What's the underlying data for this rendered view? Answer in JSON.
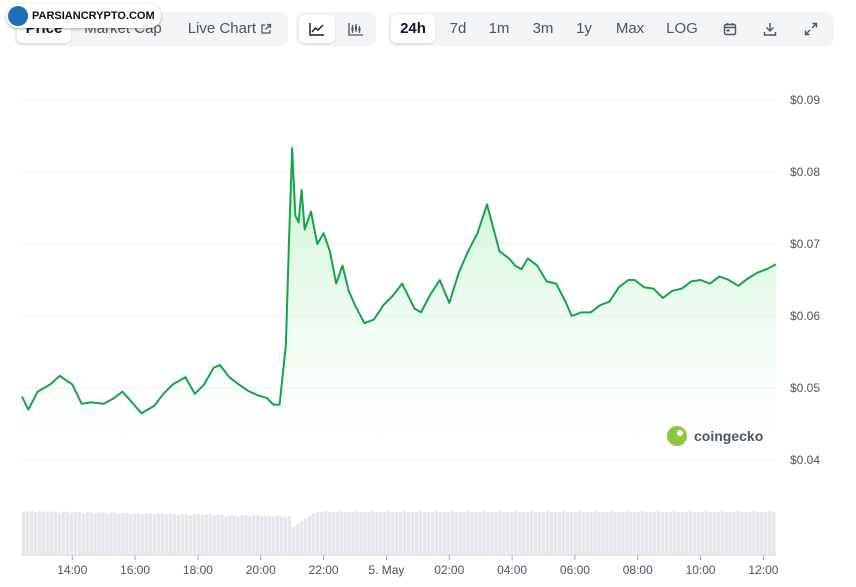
{
  "watermark": {
    "text": "PARSIANCRYPTO.COM"
  },
  "tabs": {
    "price": "Price",
    "market_cap": "Market Cap",
    "live_chart": "Live Chart"
  },
  "ranges": {
    "r24h": "24h",
    "r7d": "7d",
    "r1m": "1m",
    "r3m": "3m",
    "r1y": "1y",
    "max": "Max",
    "log": "LOG"
  },
  "brand": {
    "name": "coingecko"
  },
  "colors": {
    "line": "#16a34a",
    "fill_top": "#bbf0c9",
    "volume": "#e5e7eb",
    "grid": "#eeeeee"
  },
  "chart_data": {
    "type": "line",
    "ylim": [
      0.04,
      0.09
    ],
    "y_ticks": [
      "$0.09",
      "$0.08",
      "$0.07",
      "$0.06",
      "$0.05",
      "$0.04"
    ],
    "y_tick_values": [
      0.09,
      0.08,
      0.07,
      0.06,
      0.05,
      0.04
    ],
    "x_ticks": [
      "14:00",
      "16:00",
      "18:00",
      "20:00",
      "22:00",
      "5. May",
      "02:00",
      "04:00",
      "06:00",
      "08:00",
      "10:00",
      "12:00"
    ],
    "x_tick_hours": [
      14,
      16,
      18,
      20,
      22,
      24,
      26,
      28,
      30,
      32,
      34,
      36
    ],
    "xlim_hours": [
      12.4,
      36.4
    ],
    "series": [
      {
        "x_hours": [
          12.4,
          12.6,
          12.9,
          13.3,
          13.6,
          14.0,
          14.3,
          14.6,
          15.0,
          15.3,
          15.6,
          15.9,
          16.2,
          16.6,
          16.9,
          17.2,
          17.6,
          17.9,
          18.2,
          18.5,
          18.7,
          19.0,
          19.3,
          19.6,
          19.9,
          20.2,
          20.4,
          20.6,
          20.8,
          20.9,
          21.0,
          21.1,
          21.2,
          21.3,
          21.4,
          21.6,
          21.8,
          22.0,
          22.2,
          22.4,
          22.6,
          22.8,
          23.0,
          23.3,
          23.6,
          23.9,
          24.2,
          24.5,
          24.9,
          25.1,
          25.4,
          25.7,
          26.0,
          26.3,
          26.6,
          26.9,
          27.2,
          27.6,
          27.9,
          28.1,
          28.3,
          28.5,
          28.8,
          29.1,
          29.4,
          29.7,
          29.9,
          30.2,
          30.5,
          30.8,
          31.1,
          31.4,
          31.7,
          31.9,
          32.2,
          32.5,
          32.8,
          33.1,
          33.4,
          33.7,
          34.0,
          34.3,
          34.6,
          34.9,
          35.2,
          35.5,
          35.8,
          36.1,
          36.4
        ],
        "values": [
          0.0488,
          0.047,
          0.0495,
          0.0505,
          0.0517,
          0.0505,
          0.0478,
          0.048,
          0.0478,
          0.0485,
          0.0495,
          0.048,
          0.0465,
          0.0475,
          0.0492,
          0.0505,
          0.0515,
          0.0492,
          0.0505,
          0.0528,
          0.0532,
          0.0515,
          0.0505,
          0.0496,
          0.049,
          0.0486,
          0.0477,
          0.0477,
          0.056,
          0.0705,
          0.0833,
          0.074,
          0.073,
          0.0775,
          0.072,
          0.0745,
          0.07,
          0.0715,
          0.069,
          0.0645,
          0.067,
          0.0635,
          0.0615,
          0.059,
          0.0595,
          0.0615,
          0.0628,
          0.0645,
          0.061,
          0.0605,
          0.063,
          0.065,
          0.0618,
          0.066,
          0.069,
          0.0715,
          0.0755,
          0.069,
          0.068,
          0.067,
          0.0665,
          0.068,
          0.067,
          0.0648,
          0.0645,
          0.062,
          0.06,
          0.0605,
          0.0605,
          0.0615,
          0.062,
          0.064,
          0.065,
          0.065,
          0.064,
          0.0638,
          0.0625,
          0.0635,
          0.0638,
          0.0648,
          0.065,
          0.0645,
          0.0655,
          0.065,
          0.0642,
          0.0652,
          0.066,
          0.0665,
          0.0672
        ]
      }
    ],
    "grid": true,
    "legend": "none"
  }
}
